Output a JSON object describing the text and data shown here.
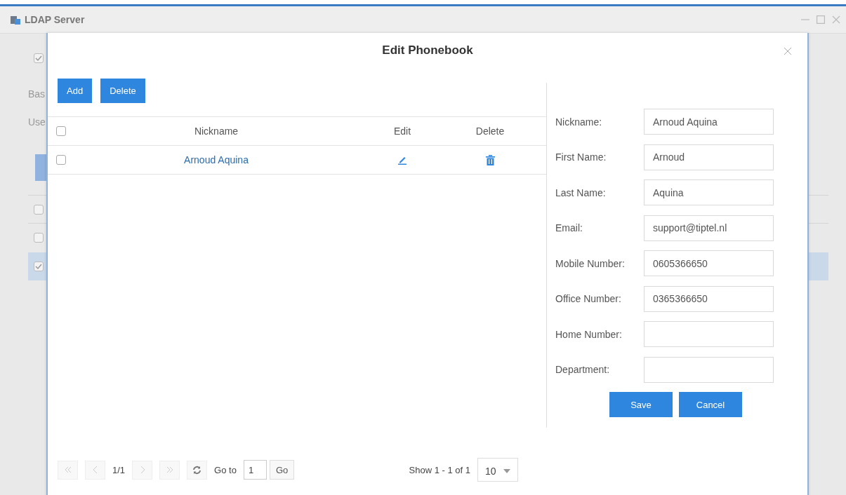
{
  "window": {
    "title": "LDAP Server"
  },
  "background": {
    "checked": true,
    "labels": [
      "Bas",
      "Use"
    ],
    "rows": [
      {
        "selected": false
      },
      {
        "selected": false
      },
      {
        "selected": true
      }
    ]
  },
  "dialog": {
    "title": "Edit Phonebook",
    "toolbar": [
      "Add",
      "Delete"
    ],
    "table": {
      "columns": [
        "Nickname",
        "Edit",
        "Delete"
      ],
      "header_checked": false,
      "rows": [
        {
          "nickname": "Arnoud Aquina",
          "checked": false
        }
      ]
    },
    "form": {
      "fields": [
        {
          "label": "Nickname:",
          "value": "Arnoud Aquina"
        },
        {
          "label": "First Name:",
          "value": "Arnoud"
        },
        {
          "label": "Last Name:",
          "value": "Aquina"
        },
        {
          "label": "Email:",
          "value": "support@tiptel.nl"
        },
        {
          "label": "Mobile Number:",
          "value": "0605366650"
        },
        {
          "label": "Office Number:",
          "value": "0365366650"
        },
        {
          "label": "Home Number:"
        },
        {
          "label": "Department:"
        }
      ],
      "buttons": [
        "Save",
        "Cancel"
      ]
    },
    "pagination": {
      "page": "1/1",
      "goto_label": "Go to",
      "goto_value": "1",
      "go": "Go",
      "summary": "Show 1 - 1 of 1",
      "page_size": "10"
    }
  }
}
